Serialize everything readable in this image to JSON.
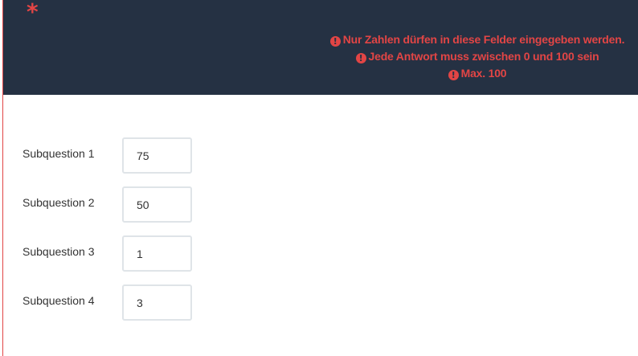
{
  "header": {
    "mandatory_marker": "*",
    "tips": [
      "Nur Zahlen dürfen in diese Felder eingegeben werden.",
      "Jede Antwort muss zwischen 0 und 100 sein",
      "Max. 100"
    ],
    "tip_icon": "exclamation-circle-icon",
    "tip_icon_glyph": "!"
  },
  "subquestions": [
    {
      "label": "Subquestion 1",
      "value": "75"
    },
    {
      "label": "Subquestion 2",
      "value": "50"
    },
    {
      "label": "Subquestion 3",
      "value": "1"
    },
    {
      "label": "Subquestion 4",
      "value": "3"
    }
  ],
  "colors": {
    "header_bg": "#253143",
    "error_red": "#e24545",
    "input_border": "#dfe4e8"
  }
}
